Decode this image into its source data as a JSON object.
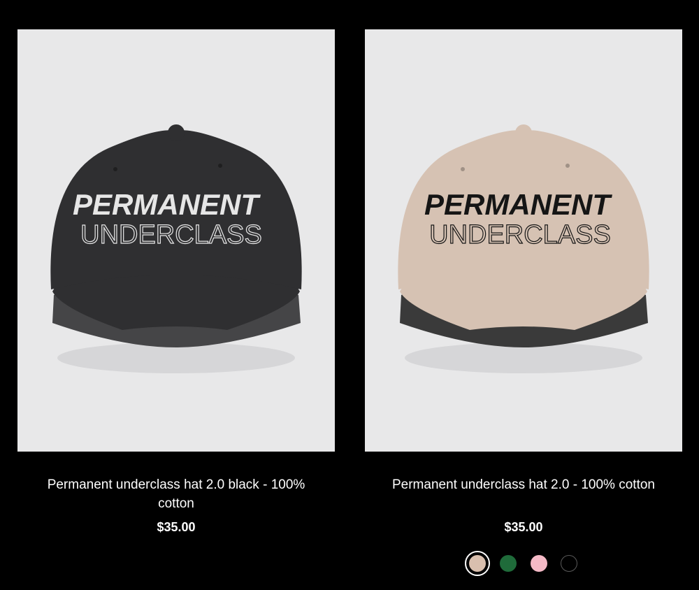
{
  "products": [
    {
      "title": "Permanent underclass hat 2.0 black - 100% cotton",
      "price": "$35.00",
      "hat_color": "#2f2f31",
      "brim_under_color": "#454547",
      "embroidery_color": "#e6e6e6",
      "embroidery_line1": "PERMANENT",
      "embroidery_line2": "UNDERCLASS"
    },
    {
      "title": "Permanent underclass hat 2.0 - 100% cotton",
      "price": "$35.00",
      "hat_color": "#d6c2b3",
      "brim_under_color": "#3a3a3a",
      "embroidery_color": "#151515",
      "embroidery_line1": "PERMANENT",
      "embroidery_line2": "UNDERCLASS",
      "swatches": [
        {
          "name": "khaki",
          "color": "#d9bfae",
          "selected": true
        },
        {
          "name": "green",
          "color": "#1f6b3a",
          "selected": false
        },
        {
          "name": "pink",
          "color": "#f4b9c6",
          "selected": false
        },
        {
          "name": "black",
          "color": "#000000",
          "selected": false
        }
      ]
    }
  ]
}
